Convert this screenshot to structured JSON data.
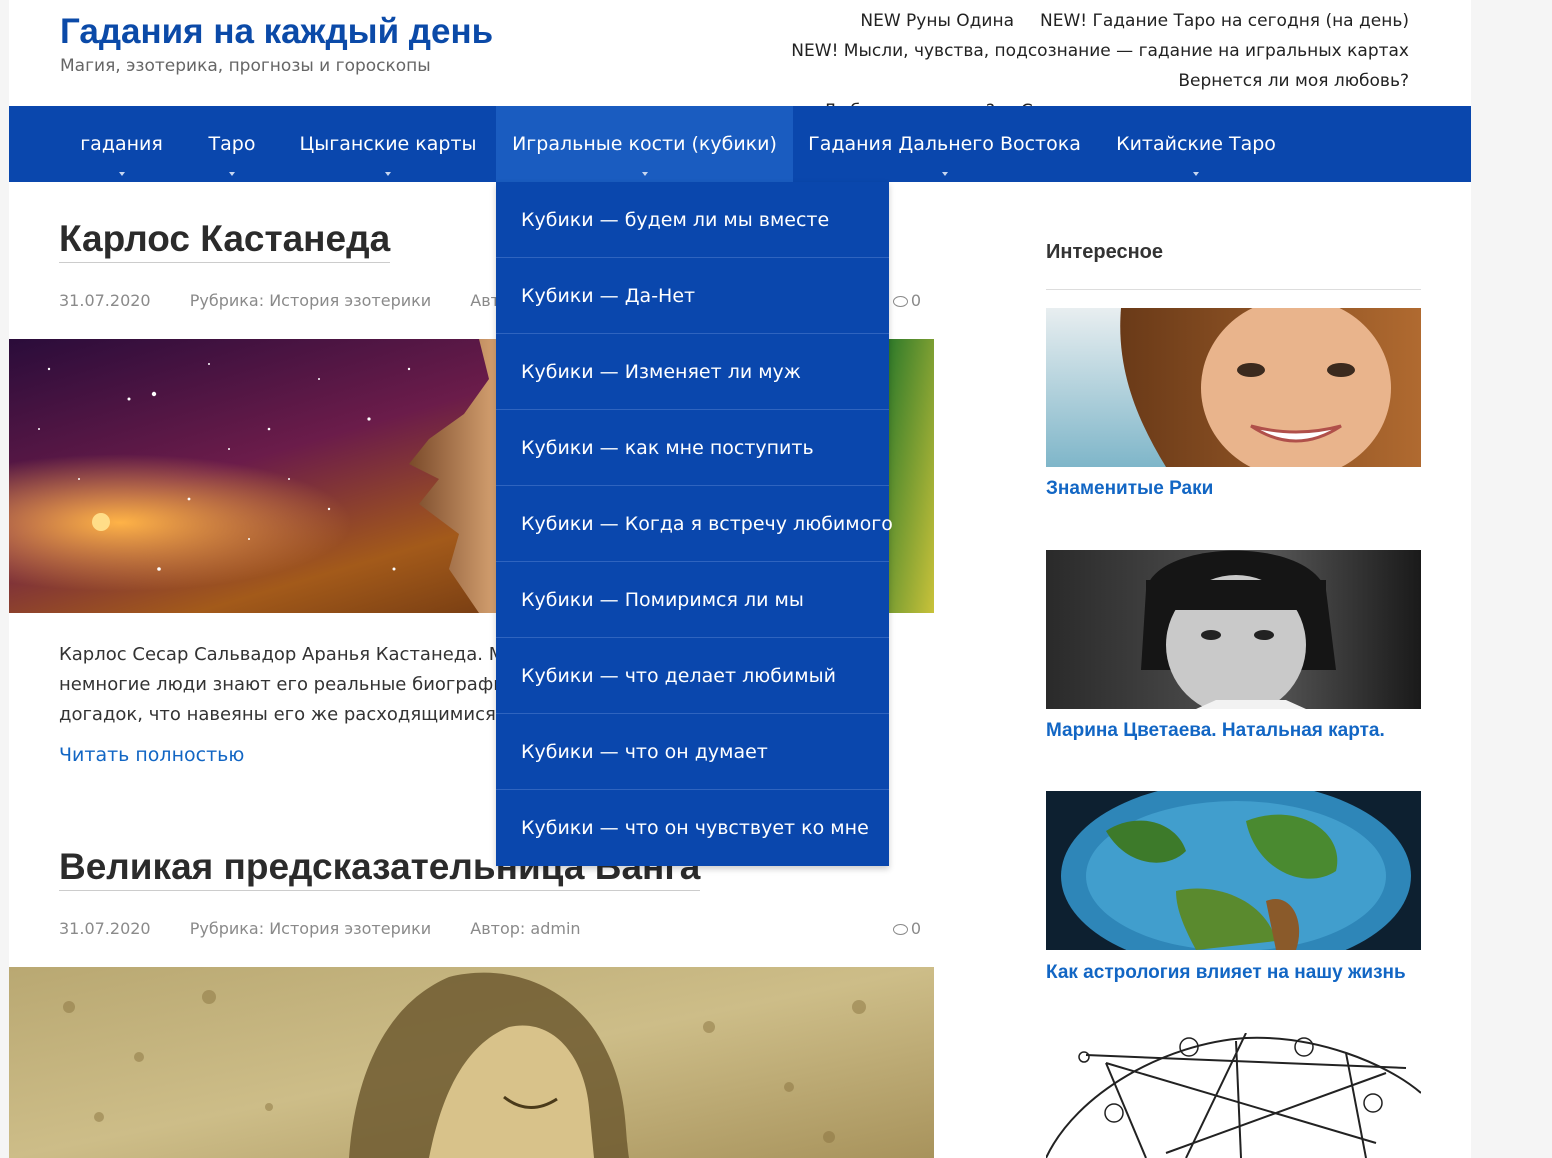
{
  "site": {
    "title": "Гадания на каждый день",
    "description": "Магия, эзотерика, прогнозы и гороскопы"
  },
  "top_links": [
    "NEW Руны Одина",
    "NEW! Гадание Таро на сегодня (на день)",
    "NEW! Мысли, чувства, подсознание — гадание на игральных картах",
    "Вернется ли моя любовь?",
    "Любит ли он меня?",
    "Совместимость по имени и дате рождения"
  ],
  "nav": {
    "items": [
      {
        "label": "гадания"
      },
      {
        "label": "Таро"
      },
      {
        "label": "Цыганские карты"
      },
      {
        "label": "Игральные кости (кубики)"
      },
      {
        "label": "Гадания Дальнего Востока"
      },
      {
        "label": "Китайские Таро"
      }
    ],
    "active_index": 3
  },
  "dropdown": {
    "items": [
      "Кубики — будем ли мы вместе",
      "Кубики — Да-Нет",
      "Кубики — Изменяет ли муж",
      "Кубики — как мне поступить",
      "Кубики — Когда я встречу любимого",
      "Кубики — Помиримся ли мы",
      "Кубики — что делает любимый",
      "Кубики — что он думает",
      "Кубики — что он чувствует ко мне"
    ]
  },
  "posts": [
    {
      "title": "Карлос Кастанеда",
      "date": "31.07.2020",
      "category": "Рубрика: История эзотерики",
      "author": "Автор: admin",
      "comments": "0",
      "excerpt": "Карлос Сесар Сальвадор Аранья Кастанеда. Мы знаем о нем немногое, ведь лишь немногие люди знают его реальные биографические данные. Много противоречий и догадок, что навеяны его же расходящимися признаниями. Однако...",
      "read_more": "Читать полностью"
    },
    {
      "title": "Великая предсказательница Ванга",
      "date": "31.07.2020",
      "category": "Рубрика: История эзотерики",
      "author": "Автор: admin",
      "comments": "0"
    }
  ],
  "sidebar": {
    "widget_title": "Интересное",
    "items": [
      {
        "title": "Знаменитые Раки"
      },
      {
        "title": "Марина Цветаева. Натальная карта."
      },
      {
        "title": "Как астрология влияет на нашу жизнь"
      }
    ]
  },
  "colors": {
    "brand_blue": "#0a47ad",
    "link_blue": "#1266c4",
    "title_blue": "#0b4aa8"
  }
}
